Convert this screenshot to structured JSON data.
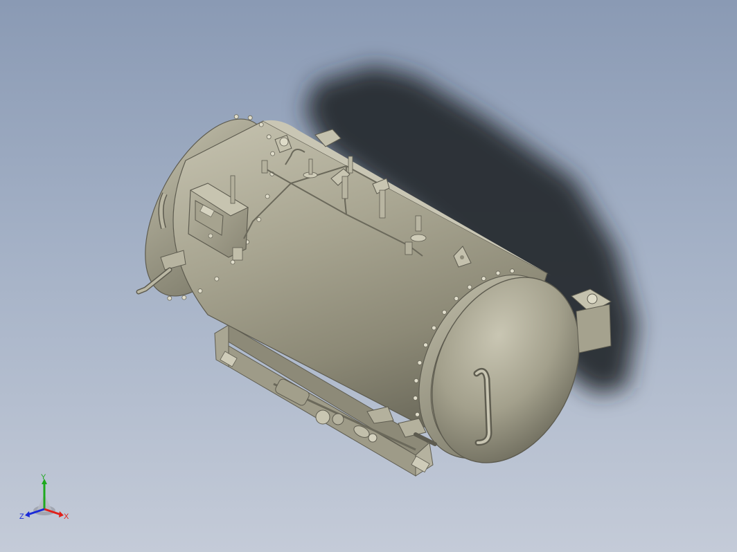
{
  "viewport": {
    "background_top": "#8a9ab4",
    "background_bottom": "#c4cbd8"
  },
  "model": {
    "object": "horizontal-pressure-vessel",
    "body_color": "#9d9a86",
    "shadow_color": "#23262b"
  },
  "triad": {
    "x_label": "X",
    "y_label": "Y",
    "z_label": "Z",
    "x_color": "#e0201a",
    "y_color": "#1ea91e",
    "z_color": "#1a2ad8"
  }
}
